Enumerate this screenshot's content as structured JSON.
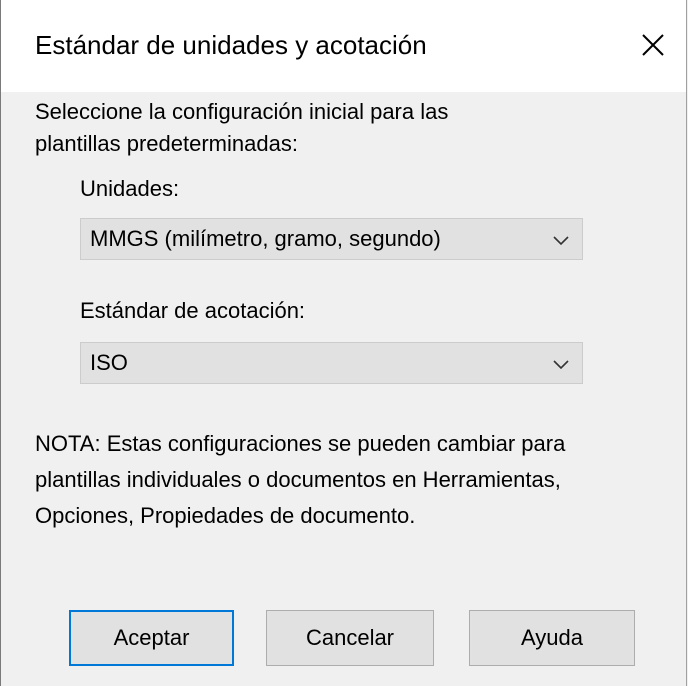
{
  "window": {
    "title": "Estándar de unidades y acotación",
    "close_icon": "close-icon"
  },
  "intro": {
    "line1": "Seleccione la configuración inicial para las",
    "line2": "plantillas predeterminadas:"
  },
  "units": {
    "label": "Unidades:",
    "selected": "MMGS (milímetro, gramo, segundo)"
  },
  "dimension_standard": {
    "label": "Estándar de acotación:",
    "selected": "ISO"
  },
  "note": {
    "line1": "NOTA: Estas configuraciones se pueden cambiar para",
    "line2": "plantillas individuales o documentos en Herramientas,",
    "line3": "Opciones, Propiedades de documento."
  },
  "buttons": {
    "ok": "Aceptar",
    "cancel": "Cancelar",
    "help": "Ayuda"
  },
  "colors": {
    "default_button_border": "#0078d7",
    "dialog_background": "#f0f0f0",
    "titlebar_background": "#ffffff"
  }
}
